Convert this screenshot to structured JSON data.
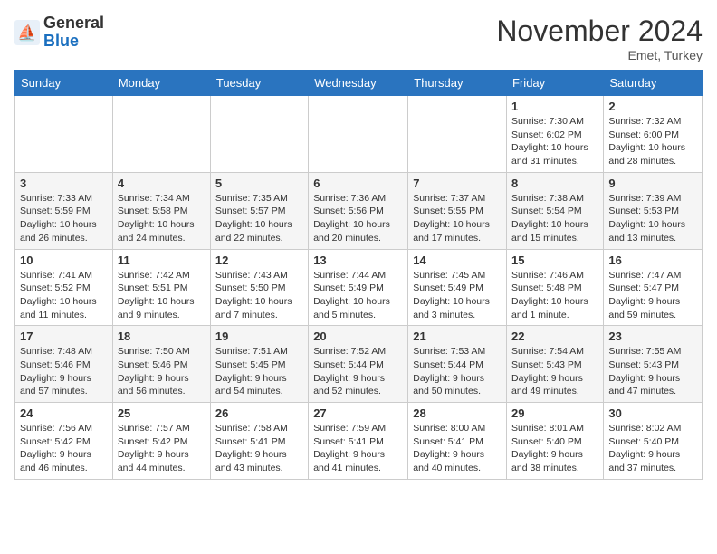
{
  "logo": {
    "general": "General",
    "blue": "Blue"
  },
  "header": {
    "month": "November 2024",
    "location": "Emet, Turkey"
  },
  "days_of_week": [
    "Sunday",
    "Monday",
    "Tuesday",
    "Wednesday",
    "Thursday",
    "Friday",
    "Saturday"
  ],
  "weeks": [
    [
      {
        "day": "",
        "info": ""
      },
      {
        "day": "",
        "info": ""
      },
      {
        "day": "",
        "info": ""
      },
      {
        "day": "",
        "info": ""
      },
      {
        "day": "",
        "info": ""
      },
      {
        "day": "1",
        "info": "Sunrise: 7:30 AM\nSunset: 6:02 PM\nDaylight: 10 hours and 31 minutes."
      },
      {
        "day": "2",
        "info": "Sunrise: 7:32 AM\nSunset: 6:00 PM\nDaylight: 10 hours and 28 minutes."
      }
    ],
    [
      {
        "day": "3",
        "info": "Sunrise: 7:33 AM\nSunset: 5:59 PM\nDaylight: 10 hours and 26 minutes."
      },
      {
        "day": "4",
        "info": "Sunrise: 7:34 AM\nSunset: 5:58 PM\nDaylight: 10 hours and 24 minutes."
      },
      {
        "day": "5",
        "info": "Sunrise: 7:35 AM\nSunset: 5:57 PM\nDaylight: 10 hours and 22 minutes."
      },
      {
        "day": "6",
        "info": "Sunrise: 7:36 AM\nSunset: 5:56 PM\nDaylight: 10 hours and 20 minutes."
      },
      {
        "day": "7",
        "info": "Sunrise: 7:37 AM\nSunset: 5:55 PM\nDaylight: 10 hours and 17 minutes."
      },
      {
        "day": "8",
        "info": "Sunrise: 7:38 AM\nSunset: 5:54 PM\nDaylight: 10 hours and 15 minutes."
      },
      {
        "day": "9",
        "info": "Sunrise: 7:39 AM\nSunset: 5:53 PM\nDaylight: 10 hours and 13 minutes."
      }
    ],
    [
      {
        "day": "10",
        "info": "Sunrise: 7:41 AM\nSunset: 5:52 PM\nDaylight: 10 hours and 11 minutes."
      },
      {
        "day": "11",
        "info": "Sunrise: 7:42 AM\nSunset: 5:51 PM\nDaylight: 10 hours and 9 minutes."
      },
      {
        "day": "12",
        "info": "Sunrise: 7:43 AM\nSunset: 5:50 PM\nDaylight: 10 hours and 7 minutes."
      },
      {
        "day": "13",
        "info": "Sunrise: 7:44 AM\nSunset: 5:49 PM\nDaylight: 10 hours and 5 minutes."
      },
      {
        "day": "14",
        "info": "Sunrise: 7:45 AM\nSunset: 5:49 PM\nDaylight: 10 hours and 3 minutes."
      },
      {
        "day": "15",
        "info": "Sunrise: 7:46 AM\nSunset: 5:48 PM\nDaylight: 10 hours and 1 minute."
      },
      {
        "day": "16",
        "info": "Sunrise: 7:47 AM\nSunset: 5:47 PM\nDaylight: 9 hours and 59 minutes."
      }
    ],
    [
      {
        "day": "17",
        "info": "Sunrise: 7:48 AM\nSunset: 5:46 PM\nDaylight: 9 hours and 57 minutes."
      },
      {
        "day": "18",
        "info": "Sunrise: 7:50 AM\nSunset: 5:46 PM\nDaylight: 9 hours and 56 minutes."
      },
      {
        "day": "19",
        "info": "Sunrise: 7:51 AM\nSunset: 5:45 PM\nDaylight: 9 hours and 54 minutes."
      },
      {
        "day": "20",
        "info": "Sunrise: 7:52 AM\nSunset: 5:44 PM\nDaylight: 9 hours and 52 minutes."
      },
      {
        "day": "21",
        "info": "Sunrise: 7:53 AM\nSunset: 5:44 PM\nDaylight: 9 hours and 50 minutes."
      },
      {
        "day": "22",
        "info": "Sunrise: 7:54 AM\nSunset: 5:43 PM\nDaylight: 9 hours and 49 minutes."
      },
      {
        "day": "23",
        "info": "Sunrise: 7:55 AM\nSunset: 5:43 PM\nDaylight: 9 hours and 47 minutes."
      }
    ],
    [
      {
        "day": "24",
        "info": "Sunrise: 7:56 AM\nSunset: 5:42 PM\nDaylight: 9 hours and 46 minutes."
      },
      {
        "day": "25",
        "info": "Sunrise: 7:57 AM\nSunset: 5:42 PM\nDaylight: 9 hours and 44 minutes."
      },
      {
        "day": "26",
        "info": "Sunrise: 7:58 AM\nSunset: 5:41 PM\nDaylight: 9 hours and 43 minutes."
      },
      {
        "day": "27",
        "info": "Sunrise: 7:59 AM\nSunset: 5:41 PM\nDaylight: 9 hours and 41 minutes."
      },
      {
        "day": "28",
        "info": "Sunrise: 8:00 AM\nSunset: 5:41 PM\nDaylight: 9 hours and 40 minutes."
      },
      {
        "day": "29",
        "info": "Sunrise: 8:01 AM\nSunset: 5:40 PM\nDaylight: 9 hours and 38 minutes."
      },
      {
        "day": "30",
        "info": "Sunrise: 8:02 AM\nSunset: 5:40 PM\nDaylight: 9 hours and 37 minutes."
      }
    ]
  ]
}
